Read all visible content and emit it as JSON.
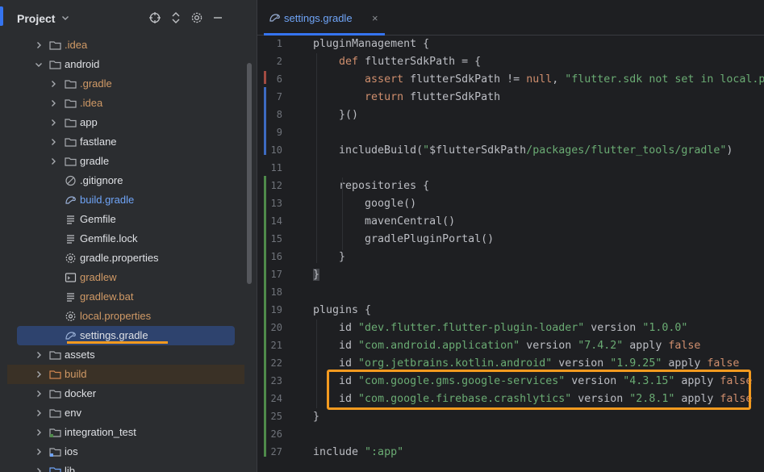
{
  "project_panel": {
    "title": "Project",
    "tools": [
      "crosshair-icon",
      "expand-collapse-icon",
      "settings-icon",
      "minimize-icon"
    ],
    "tree": [
      {
        "label": ".idea",
        "kind": "folder",
        "expander": "collapsed",
        "color": "orange"
      },
      {
        "label": "android",
        "kind": "folder",
        "expander": "expanded",
        "color": "default"
      },
      {
        "label": ".gradle",
        "kind": "folder",
        "expander": "collapsed",
        "color": "orange"
      },
      {
        "label": ".idea",
        "kind": "folder",
        "expander": "collapsed",
        "color": "orange"
      },
      {
        "label": "app",
        "kind": "folder",
        "expander": "collapsed",
        "color": "default"
      },
      {
        "label": "fastlane",
        "kind": "folder",
        "expander": "collapsed",
        "color": "default"
      },
      {
        "label": "gradle",
        "kind": "folder",
        "expander": "collapsed",
        "color": "default"
      },
      {
        "label": ".gitignore",
        "kind": "ignore",
        "expander": "none",
        "color": "default"
      },
      {
        "label": "build.gradle",
        "kind": "gradle",
        "expander": "none",
        "color": "blue"
      },
      {
        "label": "Gemfile",
        "kind": "text",
        "expander": "none",
        "color": "default"
      },
      {
        "label": "Gemfile.lock",
        "kind": "text",
        "expander": "none",
        "color": "default"
      },
      {
        "label": "gradle.properties",
        "kind": "properties",
        "expander": "none",
        "color": "default"
      },
      {
        "label": "gradlew",
        "kind": "script",
        "expander": "none",
        "color": "orange"
      },
      {
        "label": "gradlew.bat",
        "kind": "text",
        "expander": "none",
        "color": "orange"
      },
      {
        "label": "local.properties",
        "kind": "properties",
        "expander": "none",
        "color": "orange"
      },
      {
        "label": "settings.gradle",
        "kind": "gradle",
        "expander": "none",
        "color": "default",
        "selected": true
      },
      {
        "label": "assets",
        "kind": "folder",
        "expander": "collapsed",
        "color": "default"
      },
      {
        "label": "build",
        "kind": "folder-excluded",
        "expander": "collapsed",
        "color": "orange"
      },
      {
        "label": "docker",
        "kind": "folder",
        "expander": "collapsed",
        "color": "default"
      },
      {
        "label": "env",
        "kind": "folder",
        "expander": "collapsed",
        "color": "default"
      },
      {
        "label": "integration_test",
        "kind": "folder-test",
        "expander": "collapsed",
        "color": "default"
      },
      {
        "label": "ios",
        "kind": "folder-module",
        "expander": "collapsed",
        "color": "default"
      },
      {
        "label": "lib",
        "kind": "folder-source",
        "expander": "collapsed",
        "color": "default"
      }
    ]
  },
  "editor": {
    "tab": {
      "label": "settings.gradle",
      "close": "×"
    },
    "lines": [
      {
        "n": "1",
        "segs": [
          [
            "p",
            "pluginManagement "
          ],
          [
            "brace",
            "{"
          ]
        ]
      },
      {
        "n": "2",
        "segs": [
          [
            "p",
            "    "
          ],
          [
            "kw",
            "def"
          ],
          [
            "p",
            " flutterSdkPath = {"
          ]
        ]
      },
      {
        "n": "6",
        "segs": [
          [
            "p",
            "        "
          ],
          [
            "kw",
            "assert"
          ],
          [
            "p",
            " flutterSdkPath != "
          ],
          [
            "kw",
            "null"
          ],
          [
            "p",
            ", "
          ],
          [
            "str",
            "\"flutter.sdk not set in local.pro"
          ]
        ]
      },
      {
        "n": "7",
        "segs": [
          [
            "p",
            "        "
          ],
          [
            "kw",
            "return"
          ],
          [
            "p",
            " flutterSdkPath"
          ]
        ]
      },
      {
        "n": "8",
        "segs": [
          [
            "p",
            "    }()"
          ]
        ]
      },
      {
        "n": "9",
        "segs": []
      },
      {
        "n": "10",
        "segs": [
          [
            "p",
            "    includeBuild("
          ],
          [
            "str",
            "\""
          ],
          [
            "p",
            "$flutterSdkPath"
          ],
          [
            "str",
            "/packages/flutter_tools/gradle\""
          ],
          [
            "p",
            ")"
          ]
        ]
      },
      {
        "n": "11",
        "segs": []
      },
      {
        "n": "12",
        "segs": [
          [
            "p",
            "    repositories {"
          ]
        ]
      },
      {
        "n": "13",
        "segs": [
          [
            "p",
            "        google()"
          ]
        ]
      },
      {
        "n": "14",
        "segs": [
          [
            "p",
            "        mavenCentral()"
          ]
        ]
      },
      {
        "n": "15",
        "segs": [
          [
            "p",
            "        gradlePluginPortal()"
          ]
        ]
      },
      {
        "n": "16",
        "segs": [
          [
            "p",
            "    }"
          ]
        ]
      },
      {
        "n": "17",
        "segs": [
          [
            "bracehl",
            "}"
          ]
        ]
      },
      {
        "n": "18",
        "segs": []
      },
      {
        "n": "19",
        "segs": [
          [
            "p",
            "plugins {"
          ]
        ]
      },
      {
        "n": "20",
        "segs": [
          [
            "p",
            "    id "
          ],
          [
            "str",
            "\"dev.flutter.flutter-plugin-loader\""
          ],
          [
            "p",
            " version "
          ],
          [
            "str",
            "\"1.0.0\""
          ]
        ]
      },
      {
        "n": "21",
        "segs": [
          [
            "p",
            "    id "
          ],
          [
            "str",
            "\"com.android.application\""
          ],
          [
            "p",
            " version "
          ],
          [
            "str",
            "\"7.4.2\""
          ],
          [
            "p",
            " apply "
          ],
          [
            "kw",
            "false"
          ]
        ]
      },
      {
        "n": "22",
        "segs": [
          [
            "p",
            "    id "
          ],
          [
            "str",
            "\"org.jetbrains.kotlin.android\""
          ],
          [
            "p",
            " version "
          ],
          [
            "str",
            "\"1.9.25\""
          ],
          [
            "p",
            " apply "
          ],
          [
            "kw",
            "false"
          ]
        ]
      },
      {
        "n": "23",
        "segs": [
          [
            "p",
            "    id "
          ],
          [
            "str",
            "\"com.google.gms.google-services\""
          ],
          [
            "p",
            " version "
          ],
          [
            "str",
            "\"4.3.15\""
          ],
          [
            "p",
            " apply "
          ],
          [
            "kw",
            "false"
          ]
        ]
      },
      {
        "n": "24",
        "segs": [
          [
            "p",
            "    id "
          ],
          [
            "str",
            "\"com.google.firebase.crashlytics\""
          ],
          [
            "p",
            " version "
          ],
          [
            "str",
            "\"2.8.1\""
          ],
          [
            "p",
            " apply "
          ],
          [
            "kw",
            "false"
          ]
        ]
      },
      {
        "n": "25",
        "segs": [
          [
            "p",
            "}"
          ]
        ]
      },
      {
        "n": "26",
        "segs": []
      },
      {
        "n": "27",
        "segs": [
          [
            "p",
            "include "
          ],
          [
            "str",
            "\":app\""
          ]
        ]
      }
    ]
  },
  "colors": {
    "accent": "#3574f0",
    "highlight": "#f39a1f",
    "vcs_modified": "#3d6ac1",
    "vcs_added": "#4e8a4a",
    "vcs_deleted": "#a24b42"
  }
}
